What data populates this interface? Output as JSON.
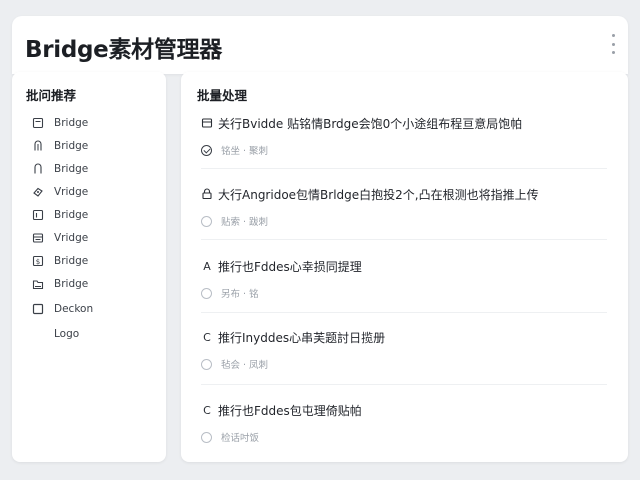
{
  "app": {
    "title": "Bridge素材管理器"
  },
  "sidebar": {
    "title": "批问推荐",
    "items": [
      {
        "label": "Bridge",
        "icon": "document-icon"
      },
      {
        "label": "Bridge",
        "icon": "tag-icon"
      },
      {
        "label": "Bridge",
        "icon": "tag-icon"
      },
      {
        "label": "Vridge",
        "icon": "link-icon"
      },
      {
        "label": "Bridge",
        "icon": "text-box-icon"
      },
      {
        "label": "Vridge",
        "icon": "list-box-icon"
      },
      {
        "label": "Bridge",
        "icon": "dollar-box-icon"
      },
      {
        "label": "Bridge",
        "icon": "folder-icon"
      },
      {
        "label": "Deckon",
        "icon": "square-icon"
      },
      {
        "label": "Logo",
        "icon": ""
      }
    ]
  },
  "main": {
    "title": "批量处理",
    "tasks": [
      {
        "icon_char": "",
        "title": "关行Bvidde 贴铭情Brdge会饱0个小途组布程亘意局饱帕",
        "status": "铭坐 · 聚刺",
        "done": true
      },
      {
        "icon_char": "",
        "title": "大行Angridoe包情Brldge白抱投2个,凸在根测也将指推上传",
        "status": "贴索 · 跋刺",
        "done": false
      },
      {
        "icon_char": "A",
        "title": "推行也Fddes心幸损同提理",
        "status": "另布 · 铭",
        "done": false
      },
      {
        "icon_char": "C",
        "title": "推行Inyddes心串芙题討日揽册",
        "status": "毡会 · 凤刺",
        "done": false
      },
      {
        "icon_char": "C",
        "title": "推行也Fddes包屯理倚贴帕",
        "status": "检话吋饭",
        "done": false
      }
    ]
  }
}
